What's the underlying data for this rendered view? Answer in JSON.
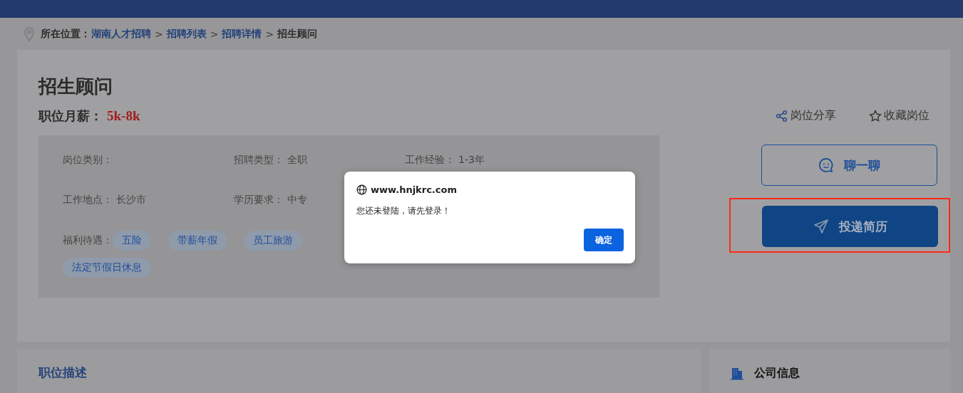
{
  "breadcrumb": {
    "label": "所在位置：",
    "items": [
      {
        "kind": "link",
        "text": "湖南人才招聘"
      },
      {
        "kind": "separator",
        "text": ">"
      },
      {
        "kind": "link",
        "text": "招聘列表"
      },
      {
        "kind": "separator",
        "text": ">"
      },
      {
        "kind": "link",
        "text": "招聘详情"
      },
      {
        "kind": "separator",
        "text": ">"
      },
      {
        "kind": "current",
        "text": "招生顾问"
      }
    ]
  },
  "job": {
    "title": "招生顾问",
    "salary_label": "职位月薪：",
    "salary": "5k-8k",
    "fields": [
      {
        "label": "岗位类别："
      },
      {
        "label": "招聘类型：",
        "value": "全职"
      },
      {
        "label": "工作经验：",
        "value": "1-3年"
      },
      {
        "label": "工作地点：",
        "value": "长沙市"
      },
      {
        "label": "学历要求：",
        "value": "中专"
      }
    ],
    "benefits_label": "福利待遇：",
    "benefits": [
      "五险",
      "带薪年假",
      "员工旅游",
      "法定节假日休息"
    ]
  },
  "actions": {
    "share": "岗位分享",
    "collect": "收藏岗位",
    "chat": "聊一聊",
    "apply": "投递简历",
    "apply_highlighted": true
  },
  "sections": {
    "description": "职位描述",
    "company": "公司信息"
  },
  "dialog": {
    "title": "www.hnjkrc.com",
    "message": "您还未登陆，请先登录！",
    "button": "确定"
  }
}
